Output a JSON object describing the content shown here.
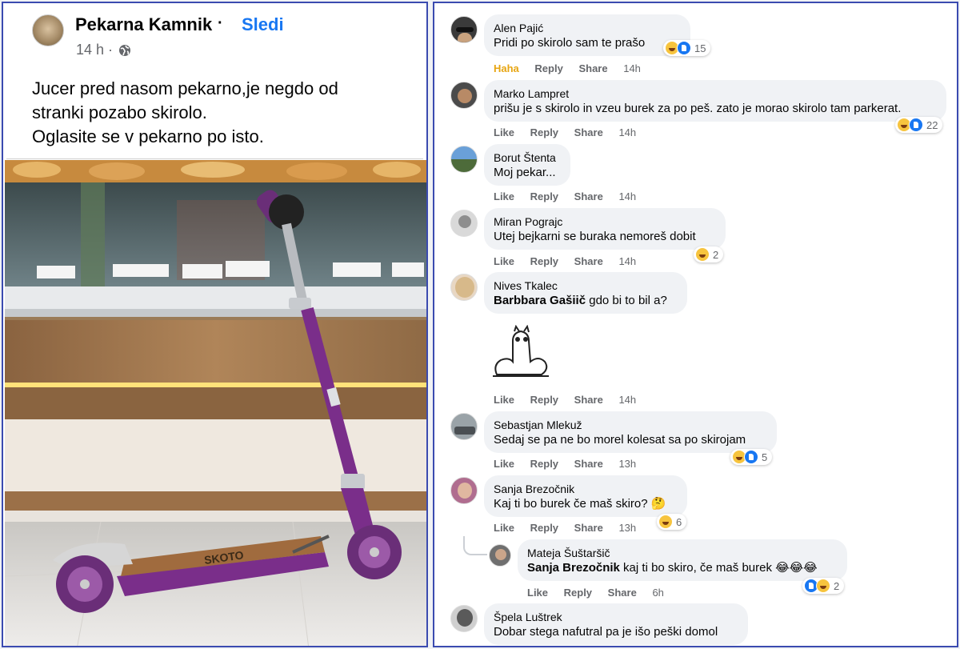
{
  "post": {
    "page_name": "Pekarna Kamnik",
    "separator": "·",
    "follow_label": "Sledi",
    "time": "14 h ·",
    "text_lines": [
      "Jucer pred nasom pekarno,je negdo od",
      "stranki pozabo skirolo.",
      "Oglasite se v pekarno po isto."
    ],
    "photo_icon": "kick-scooter-photo"
  },
  "actions": {
    "like": "Like",
    "haha": "Haha",
    "reply": "Reply",
    "share": "Share"
  },
  "comments": [
    {
      "author": "Alen Pajić",
      "text": "Pridi po skirolo sam te prašo",
      "reaction_label": "Haha",
      "time": "14h",
      "reactions": [
        "haha",
        "like"
      ],
      "count": "15"
    },
    {
      "author": "Marko Lampret",
      "text": "prišu je s skirolo in vzeu burek za po peš. zato je morao skirolo tam parkerat.",
      "time": "14h",
      "reactions": [
        "haha",
        "like"
      ],
      "count": "22"
    },
    {
      "author": "Borut Štenta",
      "text": "Moj pekar...",
      "time": "14h"
    },
    {
      "author": "Miran Pograjc",
      "text": "Utej bejkarni se buraka nemoreš dobit",
      "time": "14h",
      "reactions": [
        "haha"
      ],
      "count": "2"
    },
    {
      "author": "Nives Tkalec",
      "mention": "Barbbara Gašiič",
      "text": " gdo bi to bil a?",
      "time": "14h",
      "sticker": "cat-sticker"
    },
    {
      "author": "Sebastjan Mlekuž",
      "text": "Sedaj se pa ne bo morel kolesat sa po skirojam",
      "time": "13h",
      "reactions": [
        "haha",
        "like"
      ],
      "count": "5"
    },
    {
      "author": "Sanja Brezočnik",
      "text": "Kaj ti bo burek če maš skiro? 🤔",
      "time": "13h",
      "reactions": [
        "haha"
      ],
      "count": "6"
    },
    {
      "author": "Mateja Šuštaršič",
      "mention": "Sanja Brezočnik",
      "text": " kaj ti bo skiro, če maš burek 😂😂😂",
      "time": "6h",
      "reactions": [
        "like",
        "haha"
      ],
      "count": "2"
    },
    {
      "author": "Špela Luštrek",
      "text": "Dobar stega nafutral pa je išo peški domol"
    }
  ]
}
